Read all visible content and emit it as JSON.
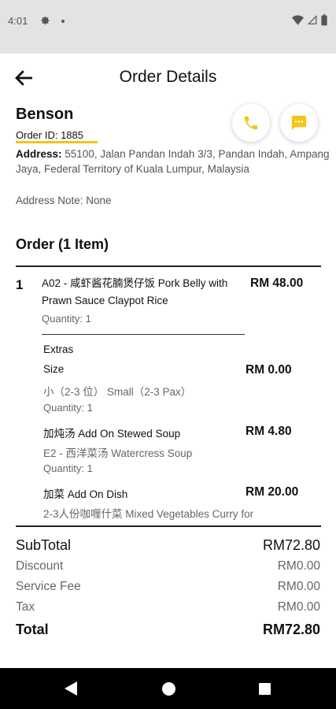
{
  "status_bar": {
    "time": "4:01",
    "icons": [
      "gear-icon",
      "dot-icon",
      "wifi-icon",
      "signal-icon",
      "battery-icon"
    ]
  },
  "header": {
    "title": "Order Details",
    "back_icon": "arrow-left-icon"
  },
  "customer": {
    "name": "Benson",
    "order_id": "Order ID: 1885",
    "address_label": "Address:",
    "address": "55100, Jalan Pandan Indah 3/3, Pandan Indah, Ampang Jaya, Federal Territory of Kuala Lumpur, Malaysia",
    "address_note": "Address Note: None"
  },
  "actions": {
    "call_icon": "phone-icon",
    "chat_icon": "chat-icon"
  },
  "order": {
    "heading": "Order (1 Item)",
    "item": {
      "qty": "1",
      "name": "A02 - 咸虾酱花腩煲仔饭 Pork Belly with Prawn Sauce Claypot Rice",
      "price": "RM 48.00",
      "quantity": "Quantity: 1"
    },
    "extras_title": "Extras",
    "extras": [
      {
        "name": "Size",
        "price": "RM 0.00",
        "option": "小（2-3 位） Small（2-3 Pax）",
        "qty": "Quantity: 1"
      },
      {
        "name": "加炖汤 Add On Stewed Soup",
        "price": "RM 4.80",
        "option": "E2 - 西洋菜汤  Watercress Soup",
        "qty": "Quantity: 1"
      },
      {
        "name": "加菜 Add On Dish",
        "price": "RM 20.00",
        "option": "2-3人份咖喱什菜  Mixed Vegetables Curry for"
      }
    ]
  },
  "summary": {
    "subtotal_label": "SubTotal",
    "subtotal": "RM72.80",
    "discount_label": "Discount",
    "discount": "RM0.00",
    "service_fee_label": "Service Fee",
    "service_fee": "RM0.00",
    "tax_label": "Tax",
    "tax": "RM0.00",
    "total_label": "Total",
    "total": "RM72.80"
  },
  "colors": {
    "accent": "#f5c518",
    "status_bar": "#e3e3e3",
    "nav_bar": "#000000"
  }
}
